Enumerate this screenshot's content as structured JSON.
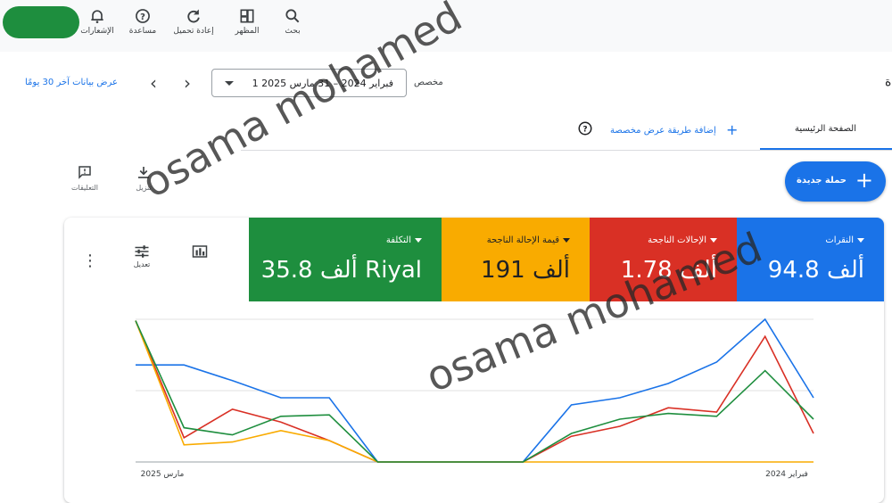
{
  "toolbar": {
    "search": "بحث",
    "appearance": "المظهر",
    "refresh": "إعادة تحميل",
    "help": "مساعدة",
    "notifications": "الإشعارات"
  },
  "datebar": {
    "custom_label": "مخصص",
    "range": "1 فبراير 2024 – 31 مارس 2025",
    "last30_label": "عرض بيانات آخر 30 يومًا"
  },
  "tabs": {
    "home": "الصفحة الرئيسية",
    "add_custom_view": "إضافة طريقة عرض مخصصة"
  },
  "actions": {
    "new_campaign": "حملة جديدة",
    "download": "تنزيل",
    "feedback": "التعليقات",
    "adjust": "تعديل"
  },
  "metrics": [
    {
      "name": "النقرات",
      "value": "94.8 ألف",
      "color": "#1a73e8"
    },
    {
      "name": "الإحالات الناجحة",
      "value": "1.78 ألف",
      "color": "#d93025"
    },
    {
      "name": "قيمة الإحالة الناجحة",
      "value": "191 ألف",
      "color": "#f9ab00"
    },
    {
      "name": "التكلفة",
      "value": "35.8 ألف Riyal",
      "color": "#1e8e3e"
    }
  ],
  "watermark": "osama mohamed",
  "chart_data": {
    "type": "line",
    "x": [
      "فبراير 2024",
      "",
      "",
      "",
      "",
      "",
      "",
      "",
      "",
      "",
      "",
      "",
      "",
      "",
      "مارس 2025"
    ],
    "x_axis_labels": {
      "start": "فبراير 2024",
      "end": "مارس 2025"
    },
    "series": [
      {
        "name": "النقرات",
        "color": "#1a73e8",
        "values": [
          45,
          100,
          70,
          55,
          45,
          40,
          0,
          0,
          0,
          0,
          45,
          45,
          57,
          68,
          68
        ]
      },
      {
        "name": "الإحالات الناجحة",
        "color": "#d93025",
        "values": [
          20,
          88,
          35,
          38,
          25,
          18,
          0,
          0,
          0,
          0,
          15,
          28,
          37,
          17,
          99
        ]
      },
      {
        "name": "قيمة الإحالة الناجحة",
        "color": "#f9ab00",
        "values": [
          0,
          0,
          0,
          0,
          0,
          0,
          0,
          0,
          0,
          0,
          15,
          22,
          14,
          12,
          99
        ]
      },
      {
        "name": "التكلفة",
        "color": "#1e8e3e",
        "values": [
          30,
          64,
          32,
          34,
          30,
          20,
          0,
          0,
          0,
          0,
          33,
          32,
          19,
          24,
          99
        ]
      }
    ],
    "ylim": [
      0,
      100
    ],
    "grid": true
  }
}
